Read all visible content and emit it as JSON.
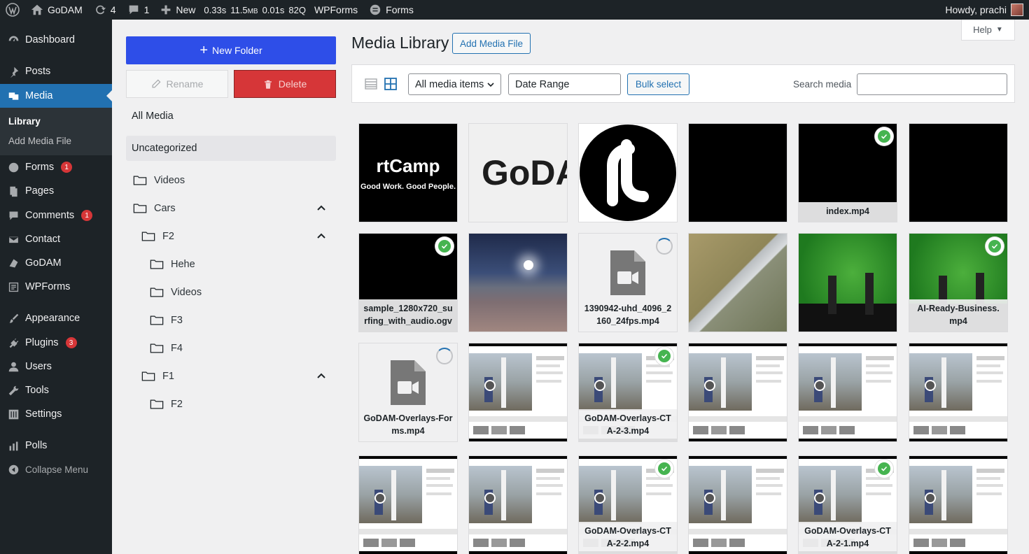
{
  "adminbar": {
    "site_name": "GoDAM",
    "updates": "4",
    "comments": "1",
    "new_label": "New",
    "perf": {
      "time": "0.33s",
      "mem": "11.5",
      "mem_unit": "MB",
      "q_time": "0.01s",
      "queries": "82Q"
    },
    "wpforms": "WPForms",
    "forms": "Forms",
    "howdy": "Howdy, prachi"
  },
  "menu": {
    "dashboard": "Dashboard",
    "posts": "Posts",
    "media": "Media",
    "library": "Library",
    "add_media": "Add Media File",
    "forms": "Forms",
    "forms_badge": "1",
    "pages": "Pages",
    "comments": "Comments",
    "comments_badge": "1",
    "contact": "Contact",
    "godam": "GoDAM",
    "wpforms": "WPForms",
    "appearance": "Appearance",
    "plugins": "Plugins",
    "plugins_badge": "3",
    "users": "Users",
    "tools": "Tools",
    "settings": "Settings",
    "polls": "Polls",
    "collapse": "Collapse Menu"
  },
  "folders": {
    "new_folder": "New Folder",
    "rename": "Rename",
    "delete": "Delete",
    "all_media": "All Media",
    "uncategorized": "Uncategorized",
    "tree": [
      "Videos",
      "Cars",
      "F2",
      "Hehe",
      "Videos",
      "F3",
      "F4",
      "F1",
      "F2"
    ]
  },
  "main": {
    "title": "Media Library",
    "add_media_file": "Add Media File",
    "help": "Help",
    "filter_type": "All media items",
    "date_range": "Date Range",
    "bulk_select": "Bulk select",
    "search_label": "Search media",
    "search_value": ""
  },
  "tiles": [
    {
      "name": "",
      "kind": "rtcamp"
    },
    {
      "name": "",
      "kind": "godam"
    },
    {
      "name": "",
      "kind": "rt-circle"
    },
    {
      "name": "",
      "kind": "black"
    },
    {
      "name": "index.mp4",
      "kind": "black",
      "checked": true
    },
    {
      "name": "",
      "kind": "black"
    },
    {
      "name": "sample_1280x720_surfing_with_audio.ogv",
      "kind": "black",
      "checked": true
    },
    {
      "name": "",
      "kind": "night"
    },
    {
      "name": "1390942-uhd_4096_2160_24fps.mp4",
      "kind": "file",
      "loading": true
    },
    {
      "name": "",
      "kind": "aerial"
    },
    {
      "name": "",
      "kind": "stage"
    },
    {
      "name": "AI-Ready-Business.mp4",
      "kind": "stage",
      "checked": true
    },
    {
      "name": "GoDAM-Overlays-Forms.mp4",
      "kind": "file",
      "loading": true
    },
    {
      "name": "",
      "kind": "screen"
    },
    {
      "name": "GoDAM-Overlays-CTA-2-3.mp4",
      "kind": "screen",
      "checked": true
    },
    {
      "name": "",
      "kind": "screen"
    },
    {
      "name": "",
      "kind": "screen"
    },
    {
      "name": "",
      "kind": "screen"
    },
    {
      "name": "",
      "kind": "screen"
    },
    {
      "name": "",
      "kind": "screen"
    },
    {
      "name": "GoDAM-Overlays-CTA-2-2.mp4",
      "kind": "screen",
      "checked": true
    },
    {
      "name": "",
      "kind": "screen"
    },
    {
      "name": "GoDAM-Overlays-CTA-2-1.mp4",
      "kind": "screen",
      "checked": true
    },
    {
      "name": "",
      "kind": "screen"
    }
  ],
  "thumb_text": {
    "rtcamp_logo": "rtCamp",
    "rtcamp_tagline": "Good Work. Good People.",
    "godam_logo": "GoDA"
  },
  "colors": {
    "accent": "#2271b1",
    "new_folder": "#2e4ee8",
    "delete": "#d63638",
    "check": "#46b450"
  }
}
